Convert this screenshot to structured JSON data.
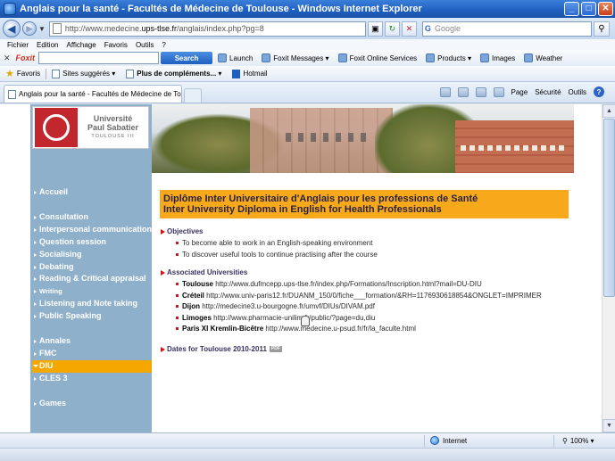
{
  "window": {
    "title": "Anglais pour la santé - Facultés de Médecine de Toulouse - Windows Internet Explorer",
    "min": "_",
    "max": "□",
    "close": "✕"
  },
  "address": {
    "url_prefix": "http://www.medecine.",
    "url_domain": "ups-tlse.fr",
    "url_suffix": "/anglais/index.php?pg=8",
    "search_placeholder": "Google",
    "search_brand": "G"
  },
  "menu": [
    "Fichier",
    "Edition",
    "Affichage",
    "Favoris",
    "Outils",
    "?"
  ],
  "foxit": {
    "brand": "Foxit",
    "search_button": "Search",
    "items": [
      "Launch",
      "Foxit Messages",
      "Foxit Online Services",
      "Products",
      "Images",
      "Weather"
    ]
  },
  "favorites": {
    "label": "Favoris",
    "items": [
      "Sites suggérés",
      "Plus de compléments...",
      "Hotmail"
    ]
  },
  "tab": {
    "title": "Anglais pour la santé - Facultés de Médecine de Toulo..."
  },
  "commands": [
    "Page",
    "Sécurité",
    "Outils"
  ],
  "logo": {
    "line1": "Université",
    "line2": "Paul Sabatier",
    "line3": "TOULOUSE III"
  },
  "nav": {
    "items": [
      {
        "label": "Accueil"
      },
      {
        "label": "Consultation"
      },
      {
        "label": "Interpersonal communication"
      },
      {
        "label": "Question session"
      },
      {
        "label": "Socialising"
      },
      {
        "label": "Debating"
      },
      {
        "label": "Reading & Critical appraisal"
      },
      {
        "label": "Writing"
      },
      {
        "label": "Listening and Note taking"
      },
      {
        "label": "Public Speaking"
      },
      {
        "label": "Annales"
      },
      {
        "label": "FMC"
      },
      {
        "label": "DIU",
        "active": true
      },
      {
        "label": "CLES 3"
      },
      {
        "label": "Games"
      }
    ]
  },
  "content": {
    "heading_line1": "Diplôme Inter Universitaire d'Anglais pour les professions de Santé",
    "heading_line2": "Inter University Diploma in English for Health Professionals",
    "objectives": {
      "title": "Objectives",
      "items": [
        "To become able to work in an English-speaking environment",
        "To discover useful tools to continue practising after the course"
      ]
    },
    "universities": {
      "title": "Associated Universities",
      "items": [
        {
          "name": "Toulouse",
          "url": "http://www.dufmcepp.ups-tlse.fr/index.php/Formations/Inscription.html?mail=DU-DIU"
        },
        {
          "name": "Créteil",
          "url": "http://www.univ-paris12.fr/DUANM_150/0/fiche___formation/&RH=1176930618854&ONGLET=IMPRIMER"
        },
        {
          "name": "Dijon",
          "url": "http://medecine3.u-bourgogne.fr/umvf/DIUs/DIVAM.pdf"
        },
        {
          "name": "Limoges",
          "url": "http://www.pharmacie-unilim.fr/public/?page=du,diu"
        },
        {
          "name": "Paris XI Kremlin-Bicêtre",
          "url": "http://www.medecine.u-psud.fr/fr/la_faculte.html"
        }
      ]
    },
    "dates": {
      "title": "Dates for Toulouse 2010-2011",
      "badge": "PDF"
    }
  },
  "status": {
    "zone": "Internet",
    "zoom": "100%"
  }
}
